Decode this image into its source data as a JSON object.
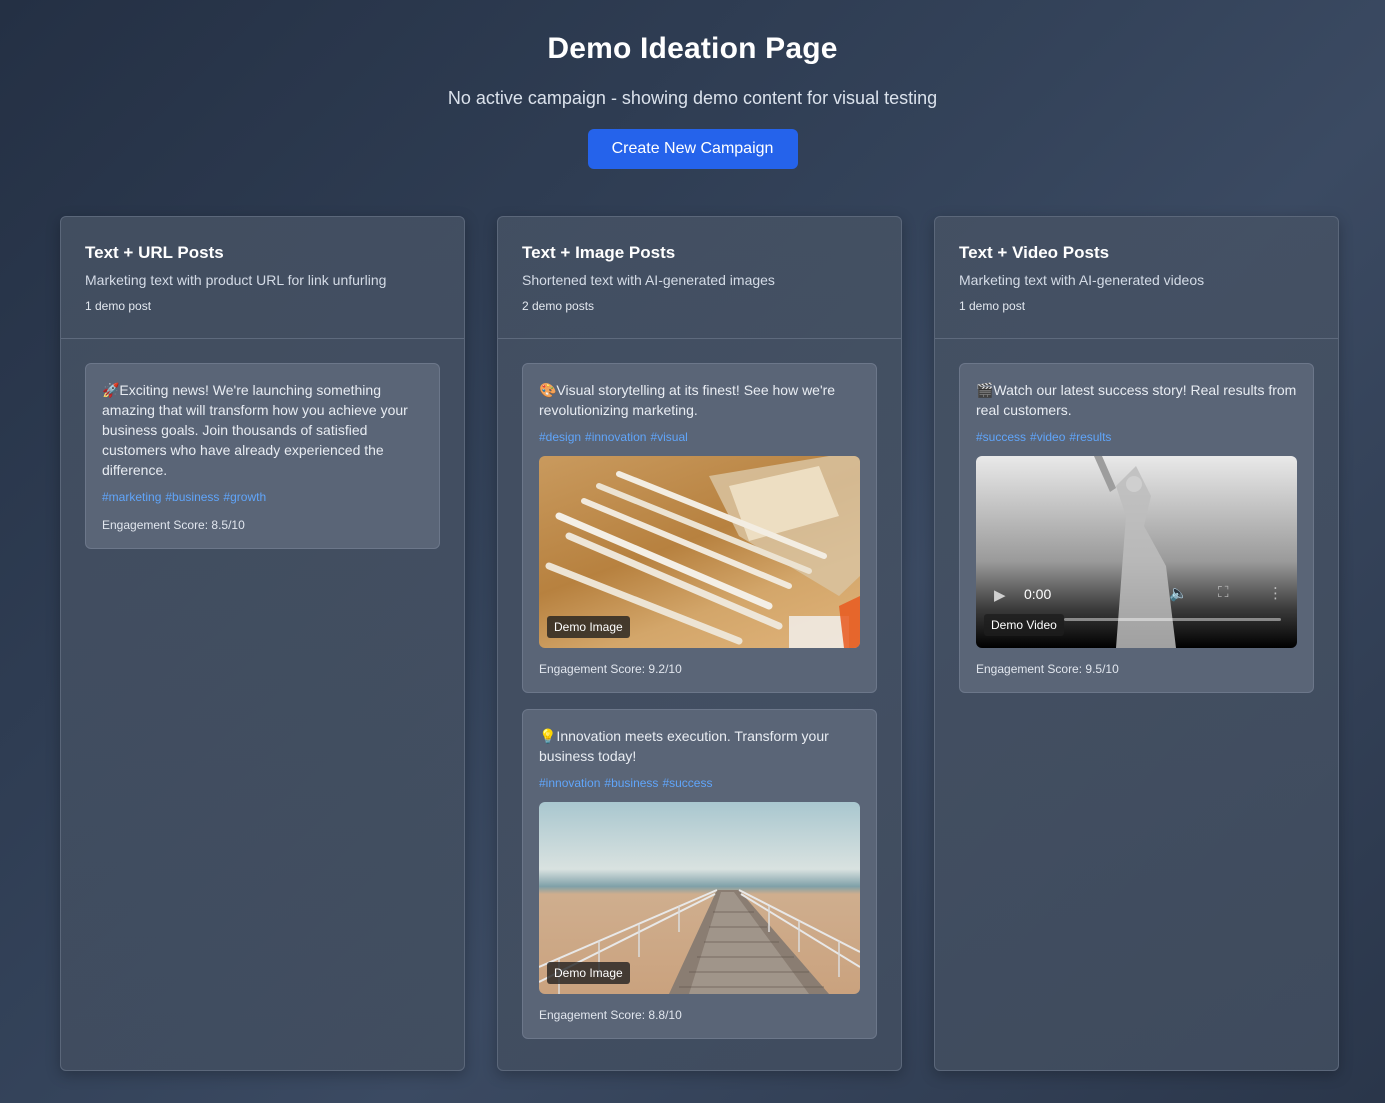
{
  "header": {
    "title": "Demo Ideation Page",
    "subtitle": "No active campaign - showing demo content for visual testing",
    "create_button": "Create New Campaign"
  },
  "columns": [
    {
      "title": "Text + URL Posts",
      "description": "Marketing text with product URL for link unfurling",
      "count": "1 demo post",
      "posts": [
        {
          "text": "🚀Exciting news! We're launching something amazing that will transform how you achieve your business goals. Join thousands of satisfied customers who have already experienced the difference.",
          "tags": [
            "#marketing",
            "#business",
            "#growth"
          ],
          "score": "Engagement Score: 8.5/10"
        }
      ]
    },
    {
      "title": "Text + Image Posts",
      "description": "Shortened text with AI-generated images",
      "count": "2 demo posts",
      "posts": [
        {
          "text": "🎨Visual storytelling at its finest! See how we're revolutionizing marketing.",
          "tags": [
            "#design",
            "#innovation",
            "#visual"
          ],
          "media_label": "Demo Image",
          "score": "Engagement Score: 9.2/10"
        },
        {
          "text": "💡Innovation meets execution. Transform your business today!",
          "tags": [
            "#innovation",
            "#business",
            "#success"
          ],
          "media_label": "Demo Image",
          "score": "Engagement Score: 8.8/10"
        }
      ]
    },
    {
      "title": "Text + Video Posts",
      "description": "Marketing text with AI-generated videos",
      "count": "1 demo post",
      "posts": [
        {
          "text": "🎬Watch our latest success story! Real results from real customers.",
          "tags": [
            "#success",
            "#video",
            "#results"
          ],
          "media_label": "Demo Video",
          "video_time": "0:00",
          "score": "Engagement Score: 9.5/10"
        }
      ]
    }
  ],
  "colors": {
    "accent": "#2563eb",
    "tag": "#60a5fa"
  }
}
